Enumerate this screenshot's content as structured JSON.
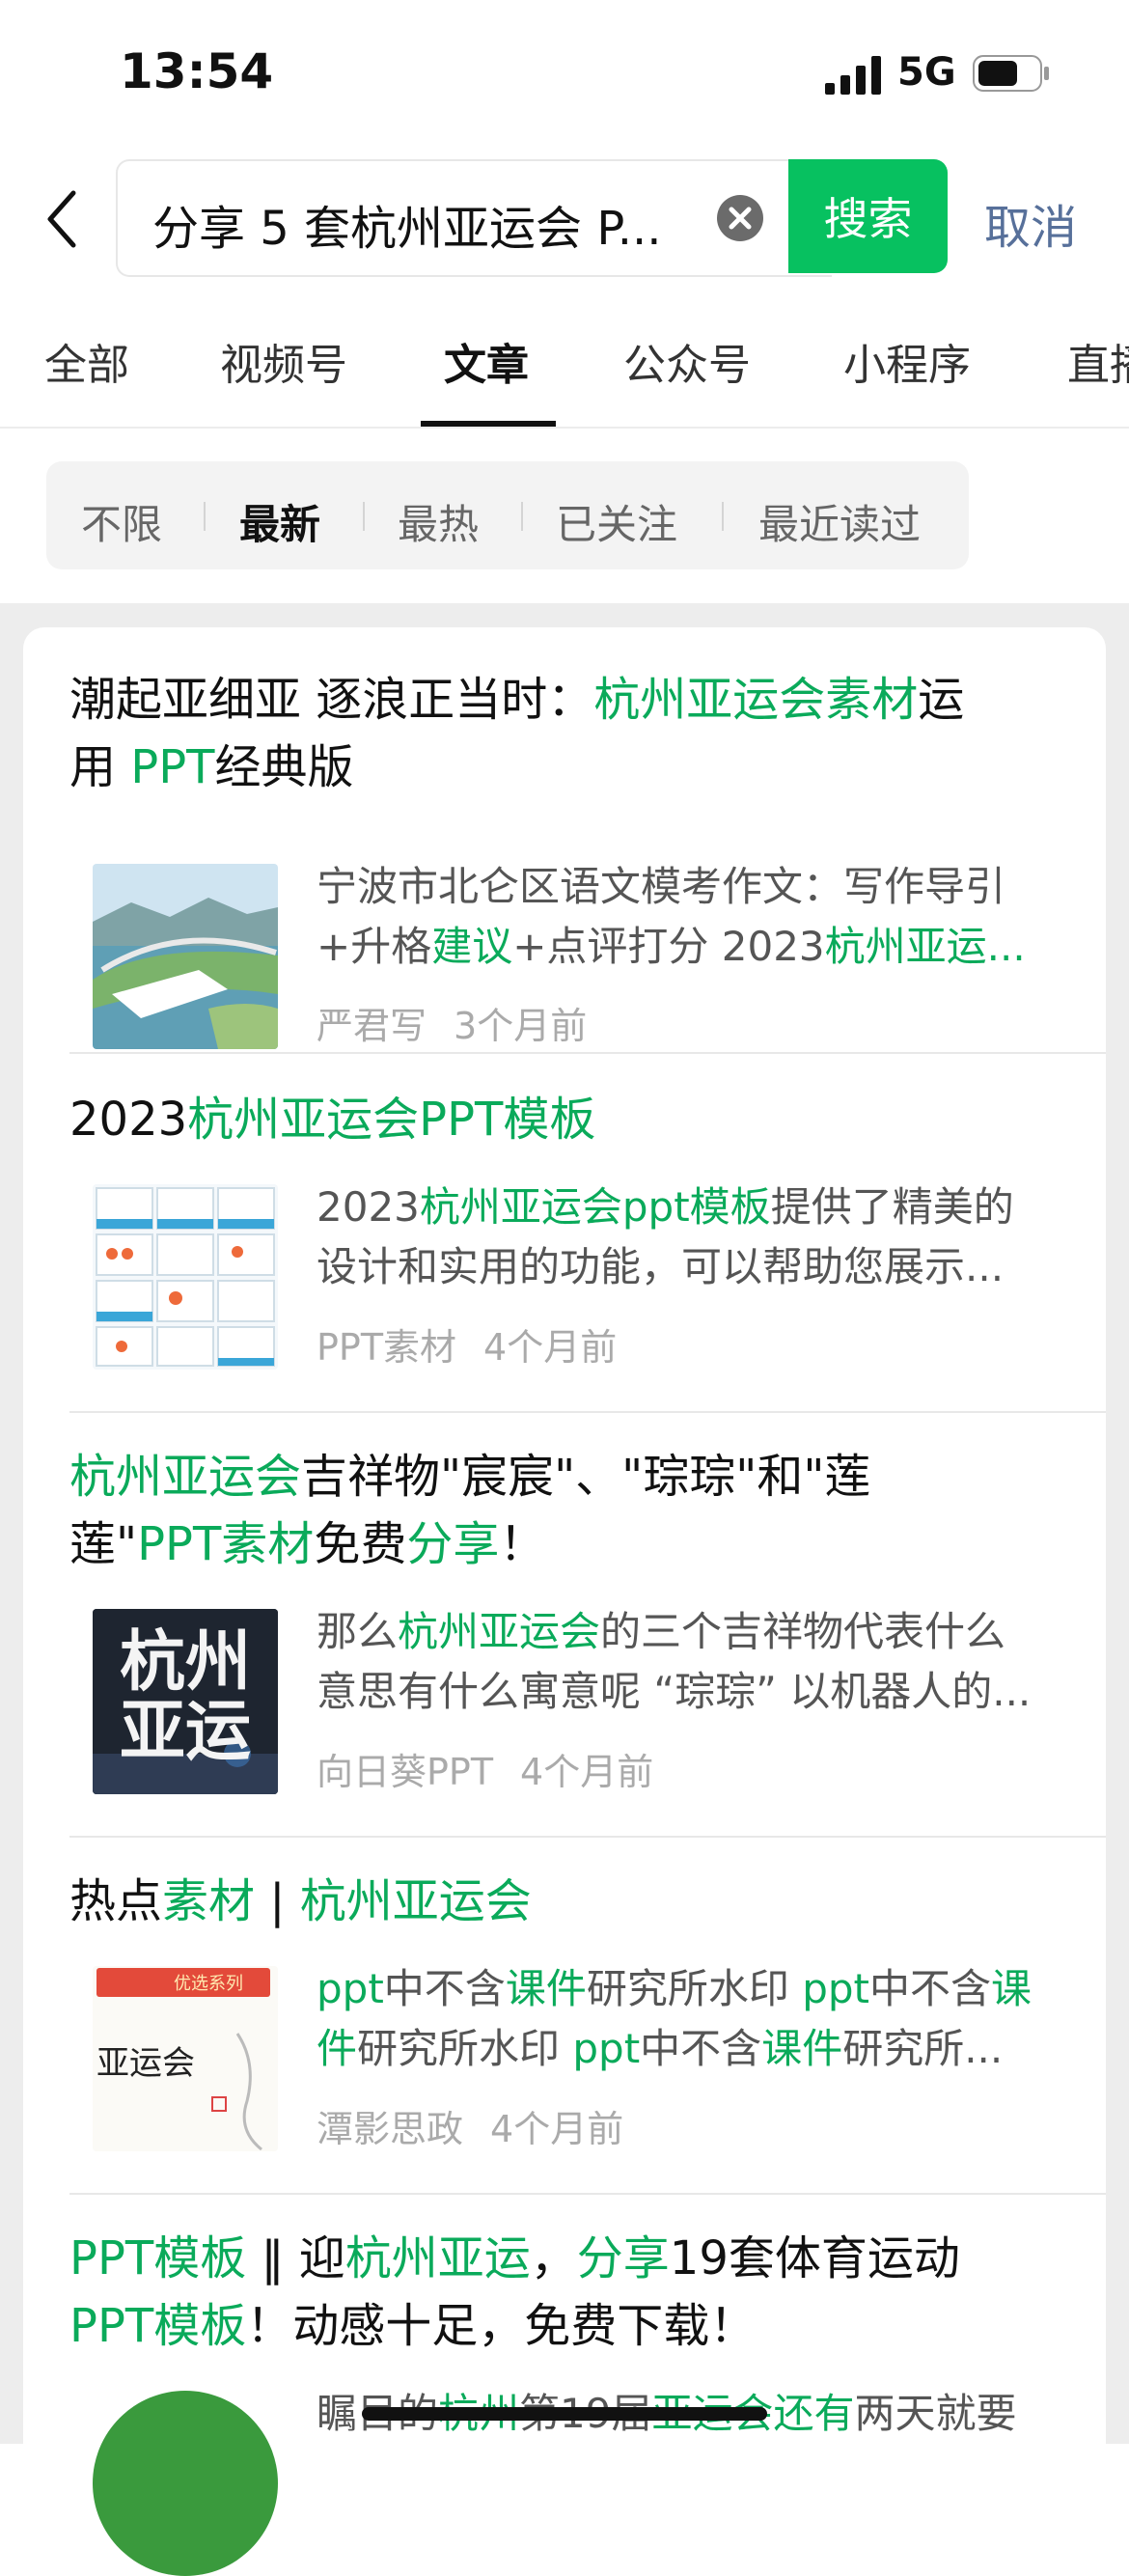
{
  "status": {
    "time": "13:54",
    "network": "5G"
  },
  "search": {
    "query": "分享 5 套杭州亚运会 P...",
    "button": "搜索",
    "cancel": "取消"
  },
  "tabs": [
    "全部",
    "视频号",
    "文章",
    "公众号",
    "小程序",
    "直播"
  ],
  "filters": [
    "不限",
    "最新",
    "最热",
    "已关注",
    "最近读过"
  ],
  "results": [
    {
      "title": [
        [
          "潮起亚细亚 逐浪正当时：",
          false
        ],
        [
          "杭州亚运会素材",
          true
        ],
        [
          "运",
          false
        ]
      ],
      "title2": [
        [
          "用 ",
          false
        ],
        [
          "PPT",
          true
        ],
        [
          "经典版",
          false
        ]
      ],
      "snippet1": [
        [
          "宁波市北仑区语文模考作文：写作导引",
          false
        ]
      ],
      "snippet2": [
        [
          "+升格",
          false
        ],
        [
          "建议",
          true
        ],
        [
          "+点评打分 2023",
          false
        ],
        [
          "杭州亚运...",
          true
        ]
      ],
      "source": "严君写",
      "time": "3个月前"
    },
    {
      "title": [
        [
          "2023",
          false
        ],
        [
          "杭州亚运会PPT模板",
          true
        ]
      ],
      "title2": [],
      "snippet1": [
        [
          "2023",
          false
        ],
        [
          "杭州亚运会ppt模板",
          true
        ],
        [
          "提供了精美的",
          false
        ]
      ],
      "snippet2": [
        [
          "设计和实用的功能，可以帮助您展示...",
          false
        ]
      ],
      "source": "PPT素材",
      "time": "4个月前"
    },
    {
      "title": [
        [
          "杭州亚运会",
          true
        ],
        [
          "吉祥物\"宸宸\"、\"琮琮\"和\"莲",
          false
        ]
      ],
      "title2": [
        [
          "莲\"",
          false
        ],
        [
          "PPT素材",
          true
        ],
        [
          "免费",
          false
        ],
        [
          "分享",
          true
        ],
        [
          "！",
          false
        ]
      ],
      "snippet1": [
        [
          "那么",
          false
        ],
        [
          "杭州亚运会",
          true
        ],
        [
          "的三个吉祥物代表什么",
          false
        ]
      ],
      "snippet2": [
        [
          "意思有什么寓意呢 “琮琮” 以机器人的...",
          false
        ]
      ],
      "source": "向日葵PPT",
      "time": "4个月前"
    },
    {
      "title": [
        [
          "热点",
          false
        ],
        [
          "素材",
          true
        ],
        [
          " | ",
          false
        ],
        [
          "杭州亚运会",
          true
        ]
      ],
      "title2": [],
      "snippet1": [
        [
          "ppt",
          true
        ],
        [
          "中不含",
          false
        ],
        [
          "课件",
          true
        ],
        [
          "研究所水印 ",
          false
        ],
        [
          "ppt",
          true
        ],
        [
          "中不含",
          false
        ],
        [
          "课",
          true
        ]
      ],
      "snippet2": [
        [
          "件",
          true
        ],
        [
          "研究所水印 ",
          false
        ],
        [
          "ppt",
          true
        ],
        [
          "中不含",
          false
        ],
        [
          "课件",
          true
        ],
        [
          "研究所...",
          false
        ]
      ],
      "source": "潭影思政",
      "time": "4个月前"
    },
    {
      "title": [
        [
          "PPT模板",
          true
        ],
        [
          " ‖ 迎",
          false
        ],
        [
          "杭州亚运",
          true
        ],
        [
          "，",
          false
        ],
        [
          "分享",
          true
        ],
        [
          "19套体育运动",
          false
        ]
      ],
      "title2": [
        [
          "PPT模板",
          true
        ],
        [
          "！动感十足，免费下载！",
          false
        ]
      ],
      "snippet1": [
        [
          "瞩目的",
          false
        ],
        [
          "杭州",
          true
        ],
        [
          "第19届",
          false
        ],
        [
          "亚运会还有",
          true
        ],
        [
          "两天就要",
          false
        ]
      ],
      "snippet2": [],
      "source": "",
      "time": ""
    }
  ],
  "thumb_texts": {
    "t3_line1": "杭州",
    "t3_line2": "亚运",
    "t4_banner": "优选系列",
    "t4_text": "亚运会"
  },
  "colors": {
    "accent": "#07c160",
    "highlight": "#0aaa5a",
    "cancel": "#57709a"
  }
}
